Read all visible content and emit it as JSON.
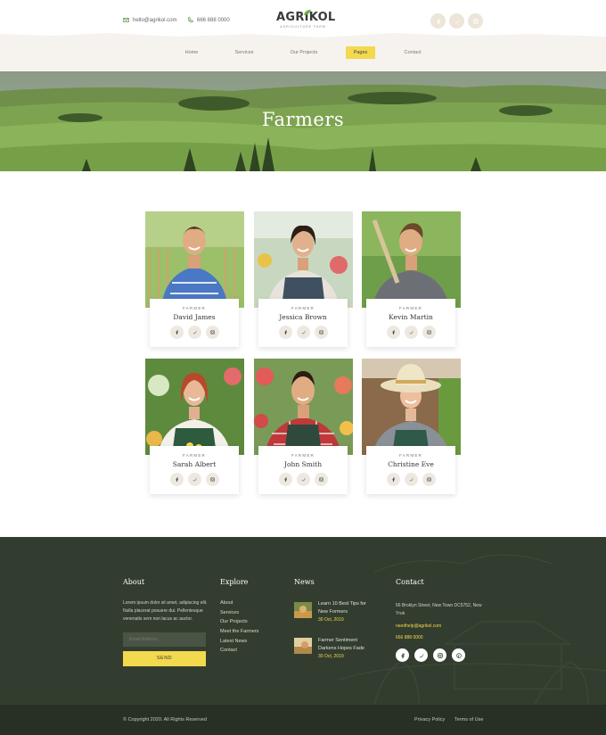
{
  "header": {
    "email": "hello@agrikol.com",
    "phone": "666 888 0000",
    "logo_name": "AGRIKOL",
    "logo_sub": "AGRICULTURE FARM",
    "social": [
      "facebook-icon",
      "twitter-icon",
      "instagram-icon"
    ]
  },
  "nav": {
    "items": [
      {
        "label": "Home"
      },
      {
        "label": "Services"
      },
      {
        "label": "Our Projects"
      },
      {
        "label": "Pages"
      },
      {
        "label": "Contact"
      }
    ],
    "active": "Pages"
  },
  "hero": {
    "title": "Farmers"
  },
  "farmers": [
    {
      "role": "FARMER",
      "name": "David James"
    },
    {
      "role": "FARMER",
      "name": "Jessica Brown"
    },
    {
      "role": "FARMER",
      "name": "Kevin Martin"
    },
    {
      "role": "FARMER",
      "name": "Sarah Albert"
    },
    {
      "role": "FARMER",
      "name": "John Smith"
    },
    {
      "role": "FARMER",
      "name": "Christine Eve"
    }
  ],
  "footer": {
    "about": {
      "heading": "About",
      "text": "Lorem ipsum dolor sit amet, adipiscing elit. Nulla placerat posuere dui. Pellentesque venenatis sem non lacus ac auctor.",
      "email_placeholder": "Email Address",
      "send_label": "SEND"
    },
    "explore": {
      "heading": "Explore",
      "links": [
        "About",
        "Services",
        "Our Projects",
        "Meet the Farmers",
        "Latest News",
        "Contact"
      ]
    },
    "news": {
      "heading": "News",
      "items": [
        {
          "title": "Learn 10 Best Tips for New Formers",
          "date": "30 Oct, 2019"
        },
        {
          "title": "Farmer Sentiment Darkens Hopes Fade",
          "date": "30 Oct, 2019"
        }
      ]
    },
    "contact": {
      "heading": "Contact",
      "address": "66 Broklyn Street, New Town DC5752, New Yrok",
      "email": "needhelp@agrikol.com",
      "phone": "666 888 0000",
      "social": [
        "facebook-icon",
        "twitter-icon",
        "instagram-icon",
        "pinterest-icon"
      ]
    },
    "copyright": "© Copyright 2020. All Rights Reserved",
    "privacy": "Privacy Policy",
    "terms": "Terms of Use"
  },
  "colors": {
    "accent": "#f2d94e",
    "footer_bg": "#333d2f",
    "footer_bottom": "#283024",
    "green": "#5a8a3a"
  }
}
